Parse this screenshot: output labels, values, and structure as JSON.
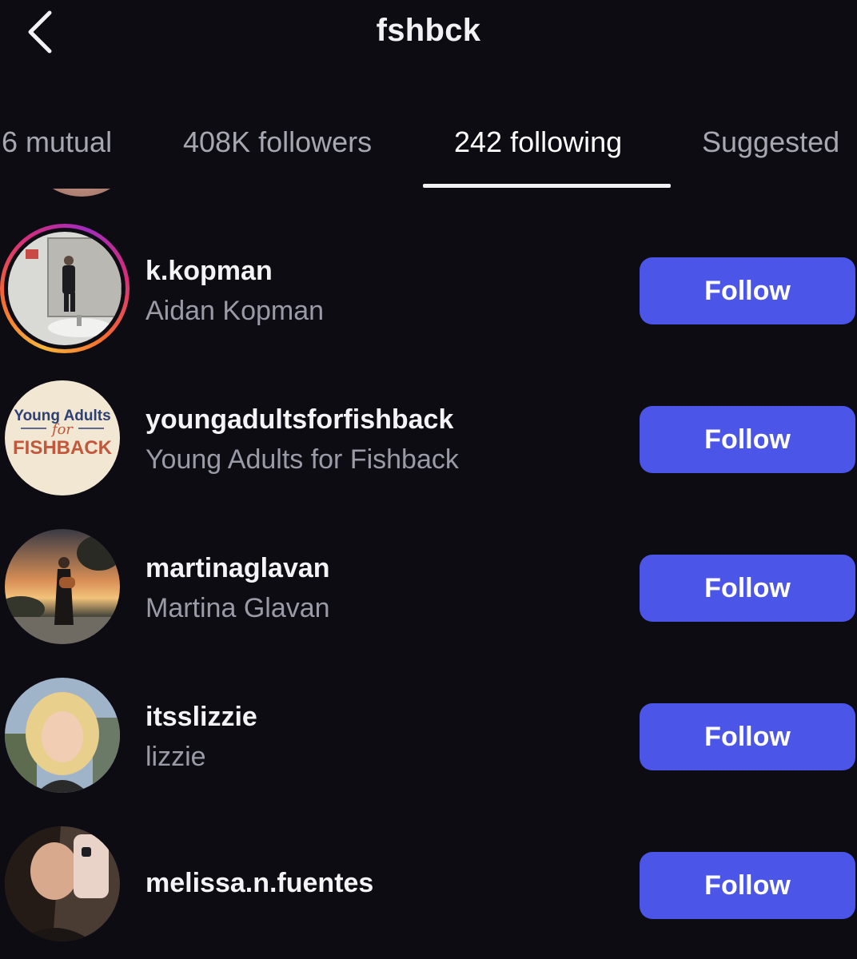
{
  "header": {
    "title": "fshbck",
    "back_icon": "chevron-left-icon"
  },
  "tabs": [
    {
      "label": "6 mutual",
      "active": false
    },
    {
      "label": "408K followers",
      "active": false
    },
    {
      "label": "242 following",
      "active": true
    },
    {
      "label": "Suggested",
      "active": false
    }
  ],
  "colors": {
    "background": "#0c0c12",
    "follow_button": "#4b55e8",
    "secondary_text": "#9b9ba8",
    "story_ring": [
      "#f7b53b",
      "#d62e7a",
      "#a22bbd"
    ]
  },
  "users": [
    {
      "username": "k.kopman",
      "full_name": "Aidan Kopman",
      "button": "Follow",
      "has_story_ring": true
    },
    {
      "username": "youngadultsforfishback",
      "full_name": "Young Adults for Fishback",
      "button": "Follow",
      "has_story_ring": false,
      "avatar_text": {
        "line1": "Young Adults",
        "line2": "for",
        "line3": "FISHBACK"
      }
    },
    {
      "username": "martinaglavan",
      "full_name": "Martina Glavan",
      "button": "Follow",
      "has_story_ring": false
    },
    {
      "username": "itsslizzie",
      "full_name": "lizzie",
      "button": "Follow",
      "has_story_ring": false
    },
    {
      "username": "melissa.n.fuentes",
      "full_name": "",
      "button": "Follow",
      "has_story_ring": false
    }
  ]
}
